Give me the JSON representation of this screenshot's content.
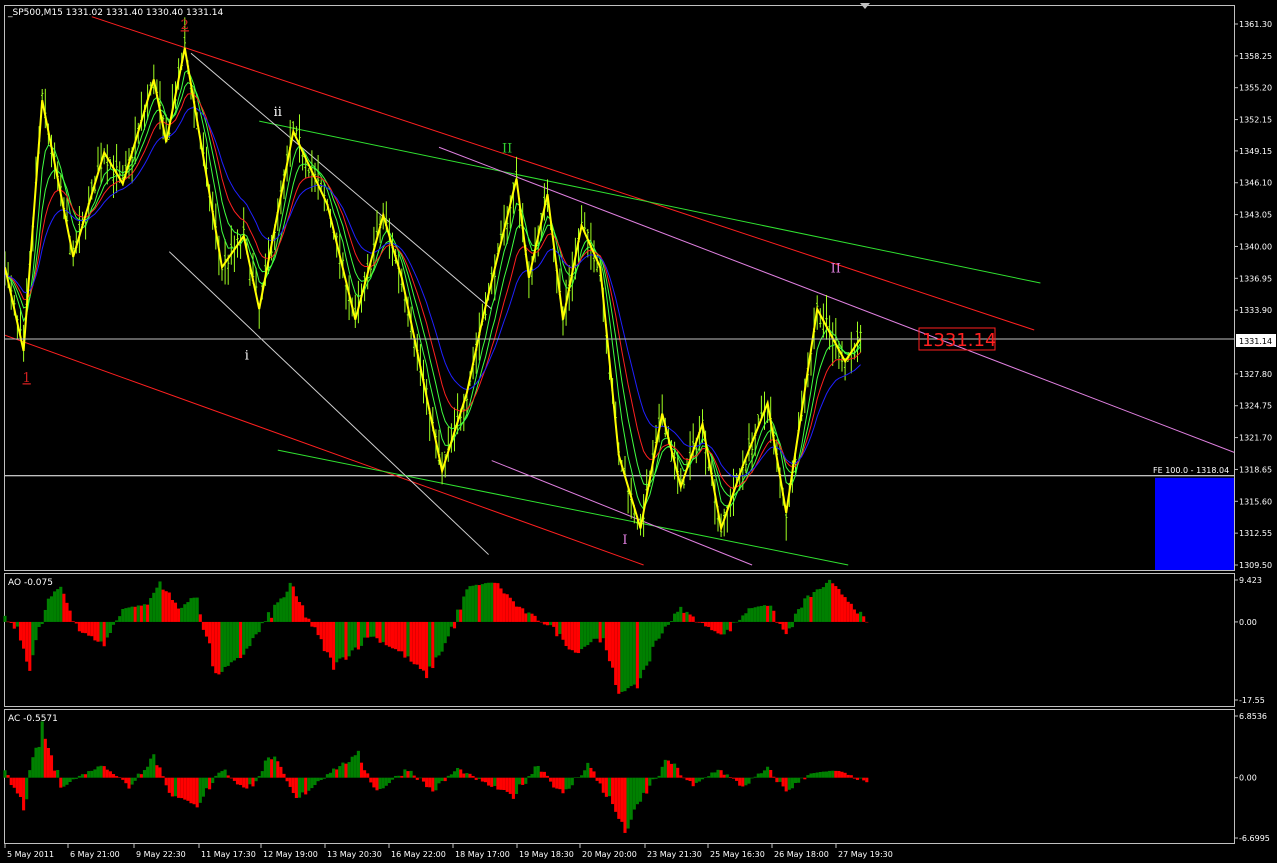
{
  "chart_data": [
    {
      "type": "candlestick",
      "title": "_SP500,M15  1331.02 1331.40 1330.40 1331.14",
      "last_price": 1331.14,
      "last_price_label": "1331.14",
      "ylim": [
        1309.5,
        1361.3
      ],
      "y_ticks": [
        "1361.30",
        "1358.25",
        "1355.20",
        "1352.15",
        "1349.15",
        "1346.10",
        "1343.05",
        "1340.00",
        "1336.95",
        "1333.90",
        "1327.80",
        "1324.75",
        "1321.70",
        "1318.65",
        "1315.60",
        "1312.55",
        "1309.50"
      ],
      "y_tick_values": [
        1361.3,
        1358.25,
        1355.2,
        1352.15,
        1349.15,
        1346.1,
        1343.05,
        1340.0,
        1336.95,
        1333.9,
        1327.8,
        1324.75,
        1321.7,
        1318.65,
        1315.6,
        1312.55,
        1309.5
      ],
      "x_labels": [
        "5 May 2011",
        "6 May 21:00",
        "9 May 22:30",
        "11 May 17:30",
        "12 May 19:00",
        "13 May 20:30",
        "16 May 22:00",
        "18 May 17:00",
        "19 May 18:30",
        "20 May 20:00",
        "23 May 21:30",
        "25 May 16:30",
        "26 May 18:00",
        "27 May 19:30"
      ],
      "fe_label": "FE 100.0 - 1318.04",
      "fe_level": 1318.04,
      "grid": false,
      "zigzag": [
        {
          "bar": 0,
          "price": 1338.0
        },
        {
          "bar": 6,
          "price": 1330.0
        },
        {
          "bar": 12,
          "price": 1354.0
        },
        {
          "bar": 22,
          "price": 1339.0
        },
        {
          "bar": 32,
          "price": 1349.0
        },
        {
          "bar": 38,
          "price": 1346.0
        },
        {
          "bar": 48,
          "price": 1356.0
        },
        {
          "bar": 52,
          "price": 1350.0
        },
        {
          "bar": 58,
          "price": 1359.0
        },
        {
          "bar": 70,
          "price": 1338.0
        },
        {
          "bar": 77,
          "price": 1341.0
        },
        {
          "bar": 82,
          "price": 1334.0
        },
        {
          "bar": 93,
          "price": 1351.0
        },
        {
          "bar": 104,
          "price": 1344.0
        },
        {
          "bar": 113,
          "price": 1333.0
        },
        {
          "bar": 122,
          "price": 1343.0
        },
        {
          "bar": 128,
          "price": 1337.0
        },
        {
          "bar": 141,
          "price": 1318.5
        },
        {
          "bar": 149,
          "price": 1326.0
        },
        {
          "bar": 154,
          "price": 1333.0
        },
        {
          "bar": 165,
          "price": 1346.5
        },
        {
          "bar": 169,
          "price": 1337.0
        },
        {
          "bar": 175,
          "price": 1345.0
        },
        {
          "bar": 180,
          "price": 1333.0
        },
        {
          "bar": 186,
          "price": 1342.0
        },
        {
          "bar": 192,
          "price": 1338.0
        },
        {
          "bar": 198,
          "price": 1320.0
        },
        {
          "bar": 205,
          "price": 1313.0
        },
        {
          "bar": 212,
          "price": 1324.0
        },
        {
          "bar": 218,
          "price": 1317.0
        },
        {
          "bar": 225,
          "price": 1323.0
        },
        {
          "bar": 231,
          "price": 1313.0
        },
        {
          "bar": 238,
          "price": 1319.0
        },
        {
          "bar": 246,
          "price": 1325.0
        },
        {
          "bar": 252,
          "price": 1314.5
        },
        {
          "bar": 262,
          "price": 1334.0
        },
        {
          "bar": 271,
          "price": 1329.0
        },
        {
          "bar": 276,
          "price": 1331.2
        }
      ],
      "wave_labels": [
        {
          "text": "1",
          "bar": 7,
          "price": 1327.0,
          "color": "#d02020"
        },
        {
          "text": "2",
          "bar": 58,
          "price": 1360.8,
          "color": "#d02020"
        },
        {
          "text": "i",
          "bar": 78,
          "price": 1329.2,
          "color": "#ffffff"
        },
        {
          "text": "ii",
          "bar": 88,
          "price": 1352.5,
          "color": "#ffffff"
        },
        {
          "text": "II",
          "bar": 162,
          "price": 1349.0,
          "color": "#30d030"
        },
        {
          "text": "I",
          "bar": 200,
          "price": 1311.5,
          "color": "#e080e0"
        },
        {
          "text": "II",
          "bar": 268,
          "price": 1337.5,
          "color": "#e080e0"
        }
      ],
      "trend_lines": [
        {
          "color": "#ff2020",
          "from": {
            "bar": 28,
            "price": 1362.0
          },
          "to": {
            "bar": 332,
            "price": 1332.0
          }
        },
        {
          "color": "#ff2020",
          "from": {
            "bar": 0,
            "price": 1331.5
          },
          "to": {
            "bar": 206,
            "price": 1309.5
          }
        },
        {
          "color": "#30e030",
          "from": {
            "bar": 82,
            "price": 1352.0
          },
          "to": {
            "bar": 334,
            "price": 1336.5
          }
        },
        {
          "color": "#30e030",
          "from": {
            "bar": 88,
            "price": 1320.5
          },
          "to": {
            "bar": 272,
            "price": 1309.5
          }
        },
        {
          "color": "#e080e0",
          "from": {
            "bar": 140,
            "price": 1349.5
          },
          "to": {
            "bar": 399,
            "price": 1320.0
          }
        },
        {
          "color": "#e080e0",
          "from": {
            "bar": 157,
            "price": 1319.5
          },
          "to": {
            "bar": 241,
            "price": 1309.5
          }
        },
        {
          "color": "#d0d0d0",
          "from": {
            "bar": 60,
            "price": 1358.5
          },
          "to": {
            "bar": 157,
            "price": 1334.0
          }
        },
        {
          "color": "#d0d0d0",
          "from": {
            "bar": 53,
            "price": 1339.5
          },
          "to": {
            "bar": 156,
            "price": 1310.5
          }
        }
      ]
    },
    {
      "type": "histogram",
      "title": "AO -0.075",
      "ylim": [
        -17.55,
        9.423
      ],
      "y_ticks": [
        "9.423",
        "0.00",
        "-17.55"
      ],
      "y_tick_values": [
        9.423,
        0.0,
        -17.55
      ],
      "profile": [
        {
          "bar": 0,
          "v": 1
        },
        {
          "bar": 4,
          "v": -2
        },
        {
          "bar": 8,
          "v": -10
        },
        {
          "bar": 14,
          "v": 5
        },
        {
          "bar": 18,
          "v": 8
        },
        {
          "bar": 24,
          "v": -2
        },
        {
          "bar": 32,
          "v": -5
        },
        {
          "bar": 38,
          "v": 3
        },
        {
          "bar": 46,
          "v": 4
        },
        {
          "bar": 50,
          "v": 9
        },
        {
          "bar": 56,
          "v": 3
        },
        {
          "bar": 62,
          "v": 6
        },
        {
          "bar": 68,
          "v": -12
        },
        {
          "bar": 76,
          "v": -8
        },
        {
          "bar": 82,
          "v": -2
        },
        {
          "bar": 92,
          "v": 8
        },
        {
          "bar": 100,
          "v": -2
        },
        {
          "bar": 106,
          "v": -10
        },
        {
          "bar": 118,
          "v": -3
        },
        {
          "bar": 128,
          "v": -7
        },
        {
          "bar": 136,
          "v": -12
        },
        {
          "bar": 142,
          "v": -5
        },
        {
          "bar": 150,
          "v": 8
        },
        {
          "bar": 158,
          "v": 9
        },
        {
          "bar": 166,
          "v": 3
        },
        {
          "bar": 176,
          "v": -1
        },
        {
          "bar": 184,
          "v": -7
        },
        {
          "bar": 192,
          "v": -3
        },
        {
          "bar": 198,
          "v": -16
        },
        {
          "bar": 204,
          "v": -14
        },
        {
          "bar": 212,
          "v": -2
        },
        {
          "bar": 218,
          "v": 3
        },
        {
          "bar": 226,
          "v": -1
        },
        {
          "bar": 232,
          "v": -3
        },
        {
          "bar": 240,
          "v": 3
        },
        {
          "bar": 246,
          "v": 4
        },
        {
          "bar": 252,
          "v": -3
        },
        {
          "bar": 258,
          "v": 5
        },
        {
          "bar": 266,
          "v": 9
        },
        {
          "bar": 272,
          "v": 5
        },
        {
          "bar": 278,
          "v": 0
        }
      ]
    },
    {
      "type": "histogram",
      "title": "AC -0.5571",
      "ylim": [
        -6.6995,
        6.8536
      ],
      "y_ticks": [
        "6.8536",
        "0.00",
        "-6.6995"
      ],
      "y_tick_values": [
        6.8536,
        0.0,
        -6.6995
      ],
      "profile": [
        {
          "bar": 0,
          "v": 0.5
        },
        {
          "bar": 6,
          "v": -3
        },
        {
          "bar": 12,
          "v": 5.5
        },
        {
          "bar": 18,
          "v": -1
        },
        {
          "bar": 26,
          "v": 0.5
        },
        {
          "bar": 32,
          "v": 1.5
        },
        {
          "bar": 40,
          "v": -1
        },
        {
          "bar": 48,
          "v": 2.5
        },
        {
          "bar": 54,
          "v": -2
        },
        {
          "bar": 62,
          "v": -3
        },
        {
          "bar": 70,
          "v": 1
        },
        {
          "bar": 78,
          "v": -1.5
        },
        {
          "bar": 86,
          "v": 2.5
        },
        {
          "bar": 94,
          "v": -2.5
        },
        {
          "bar": 104,
          "v": 0.5
        },
        {
          "bar": 114,
          "v": 2.5
        },
        {
          "bar": 120,
          "v": -1.5
        },
        {
          "bar": 130,
          "v": 1
        },
        {
          "bar": 138,
          "v": -1.5
        },
        {
          "bar": 146,
          "v": 1
        },
        {
          "bar": 154,
          "v": -0.5
        },
        {
          "bar": 164,
          "v": -2
        },
        {
          "bar": 172,
          "v": 1.5
        },
        {
          "bar": 180,
          "v": -2
        },
        {
          "bar": 188,
          "v": 1.5
        },
        {
          "bar": 196,
          "v": -3
        },
        {
          "bar": 200,
          "v": -6
        },
        {
          "bar": 206,
          "v": -2
        },
        {
          "bar": 214,
          "v": 2
        },
        {
          "bar": 222,
          "v": -1
        },
        {
          "bar": 230,
          "v": 1
        },
        {
          "bar": 238,
          "v": -1
        },
        {
          "bar": 246,
          "v": 1
        },
        {
          "bar": 252,
          "v": -1.5
        },
        {
          "bar": 260,
          "v": 0.5
        },
        {
          "bar": 268,
          "v": 0.8
        },
        {
          "bar": 278,
          "v": -0.5
        }
      ]
    }
  ],
  "colors": {
    "background": "#000000",
    "axis": "#c0c0c0",
    "candle": "#9fff20",
    "zigzag": "#ffff00",
    "ma_fast": "#40ff40",
    "ma_mid": "#ff2020",
    "ma_slow": "#2020ff",
    "histo_up": "#008000",
    "histo_down": "#ff0000",
    "fe_box": "#0000ff",
    "price_label": "#ff0000"
  }
}
